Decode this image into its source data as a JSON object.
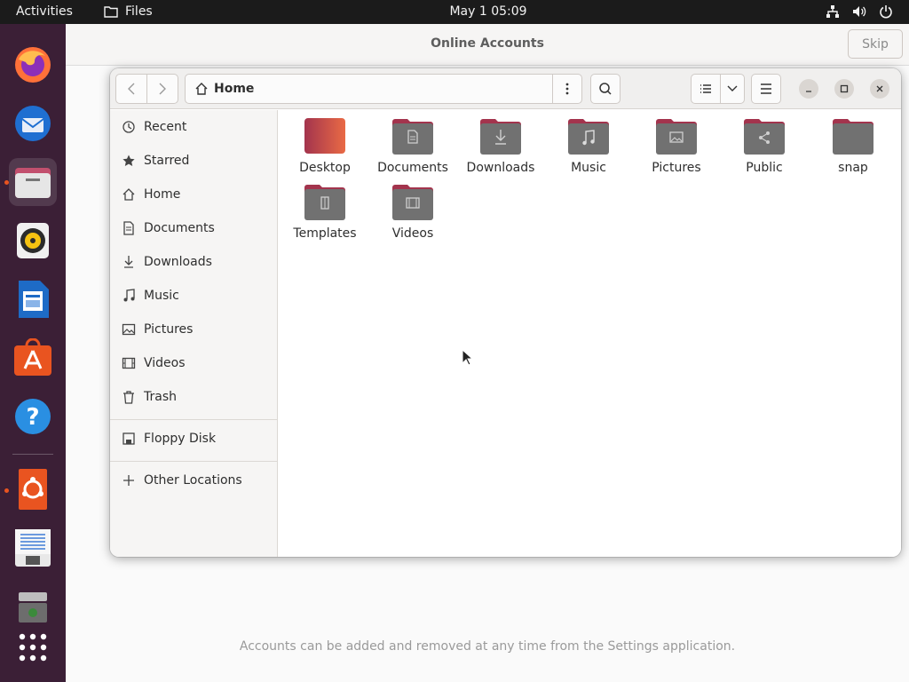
{
  "topbar": {
    "activities": "Activities",
    "app_name": "Files",
    "clock": "May 1  05:09"
  },
  "dock": {
    "apps": [
      {
        "name": "Firefox"
      },
      {
        "name": "Thunderbird"
      },
      {
        "name": "Files"
      },
      {
        "name": "Rhythmbox"
      },
      {
        "name": "LibreOffice Writer"
      },
      {
        "name": "Ubuntu Software"
      },
      {
        "name": "Help"
      },
      {
        "name": "Ubuntu Installer"
      },
      {
        "name": "Text Editor"
      },
      {
        "name": "Trash / Disk"
      },
      {
        "name": "Show Applications"
      }
    ]
  },
  "online_accounts": {
    "title": "Online Accounts",
    "skip": "Skip",
    "footer": "Accounts can be added and removed at any time from the Settings application."
  },
  "files": {
    "path": "Home",
    "sidebar": [
      {
        "label": "Recent",
        "icon": "clock-icon"
      },
      {
        "label": "Starred",
        "icon": "star-icon"
      },
      {
        "label": "Home",
        "icon": "home-icon"
      },
      {
        "label": "Documents",
        "icon": "document-icon"
      },
      {
        "label": "Downloads",
        "icon": "download-icon"
      },
      {
        "label": "Music",
        "icon": "music-icon"
      },
      {
        "label": "Pictures",
        "icon": "picture-icon"
      },
      {
        "label": "Videos",
        "icon": "video-icon"
      },
      {
        "label": "Trash",
        "icon": "trash-icon"
      },
      {
        "label": "Floppy Disk",
        "icon": "floppy-icon"
      },
      {
        "label": "Other Locations",
        "icon": "plus-icon"
      }
    ],
    "folders": [
      {
        "label": "Desktop",
        "icon": "desktop-folder-icon"
      },
      {
        "label": "Documents",
        "icon": "documents-folder-icon"
      },
      {
        "label": "Downloads",
        "icon": "downloads-folder-icon"
      },
      {
        "label": "Music",
        "icon": "music-folder-icon"
      },
      {
        "label": "Pictures",
        "icon": "pictures-folder-icon"
      },
      {
        "label": "Public",
        "icon": "public-folder-icon"
      },
      {
        "label": "snap",
        "icon": "folder-icon"
      },
      {
        "label": "Templates",
        "icon": "templates-folder-icon"
      },
      {
        "label": "Videos",
        "icon": "videos-folder-icon"
      }
    ]
  },
  "colors": {
    "dock_bg": "#3b1f36",
    "accent": "#e95420",
    "folder_tab": "#a3344d",
    "folder_body": "#717171"
  }
}
